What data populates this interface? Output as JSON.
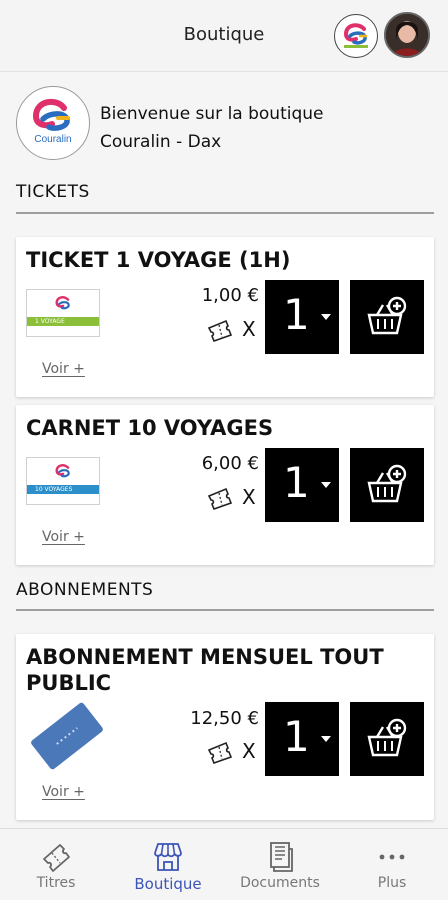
{
  "header": {
    "title": "Boutique",
    "badge_logo": "couralin-logo",
    "avatar": "user-avatar"
  },
  "welcome": {
    "line1": "Bienvenue sur la boutique",
    "line2": "Couralin - Dax",
    "logo_text": "Couralin"
  },
  "sections": {
    "tickets": "TICKETS",
    "abonnements": "ABONNEMENTS"
  },
  "products": [
    {
      "title": "TICKET 1 VOYAGE (1H)",
      "price": "1,00 €",
      "qty": "1",
      "x": "X",
      "voir": "Voir +",
      "thumb_band": "1 VOYAGE",
      "thumb_color": "#8bbf3a"
    },
    {
      "title": "CARNET 10 VOYAGES",
      "price": "6,00 €",
      "qty": "1",
      "x": "X",
      "voir": "Voir +",
      "thumb_band": "10 VOYAGES",
      "thumb_color": "#2d8fc9"
    },
    {
      "title": "ABONNEMENT MENSUEL TOUT PUBLIC",
      "price": "12,50 €",
      "qty": "1",
      "x": "X",
      "voir": "Voir +",
      "card_color": "#4a78b8"
    }
  ],
  "nav": [
    {
      "label": "Titres",
      "icon": "ticket-icon",
      "active": false
    },
    {
      "label": "Boutique",
      "icon": "shop-icon",
      "active": true
    },
    {
      "label": "Documents",
      "icon": "documents-icon",
      "active": false
    },
    {
      "label": "Plus",
      "icon": "more-icon",
      "active": false
    }
  ],
  "colors": {
    "accent": "#3c55b8",
    "button": "#000000",
    "logo_pink": "#e0306a",
    "logo_blue": "#2a6cc0"
  }
}
